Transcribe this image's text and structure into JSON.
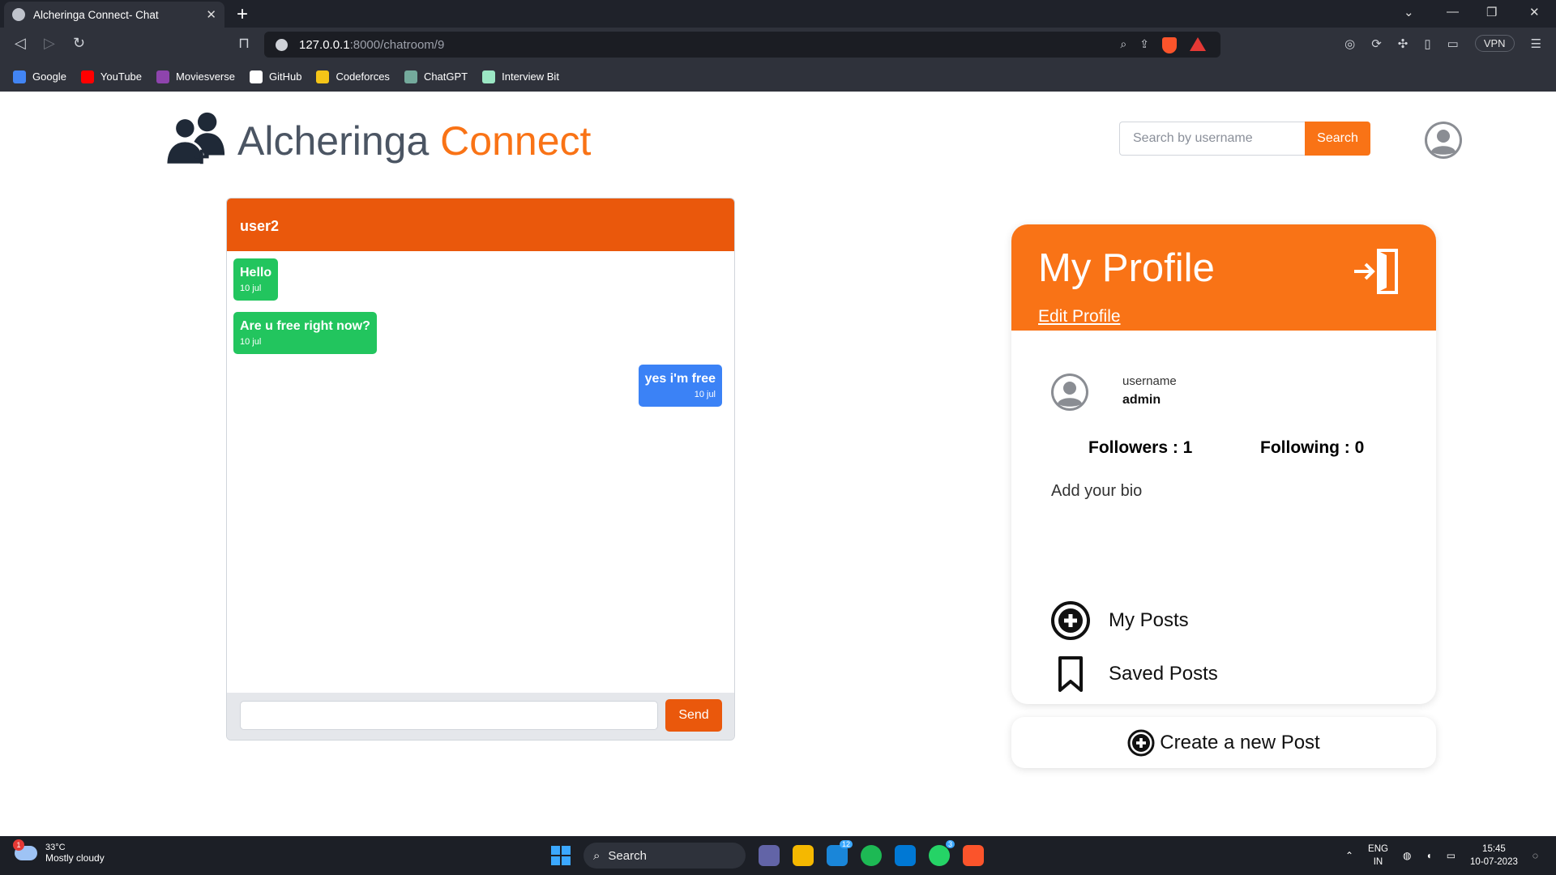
{
  "browser": {
    "tab_title": "Alcheringa Connect- Chat",
    "url_host": "127.0.0.1",
    "url_path": ":8000/chatroom/9",
    "vpn_label": "VPN",
    "bookmarks": [
      {
        "label": "Google",
        "color": "#4285f4",
        "icon": "google-icon"
      },
      {
        "label": "YouTube",
        "color": "#ff0000",
        "icon": "youtube-icon"
      },
      {
        "label": "Moviesverse",
        "color": "#8e44ad",
        "icon": "moviesverse-icon"
      },
      {
        "label": "GitHub",
        "color": "#ffffff",
        "icon": "github-icon"
      },
      {
        "label": "Codeforces",
        "color": "#f5c518",
        "icon": "codeforces-icon"
      },
      {
        "label": "ChatGPT",
        "color": "#74aa9c",
        "icon": "chatgpt-icon"
      },
      {
        "label": "Interview Bit",
        "color": "#9be7c4",
        "icon": "interviewbit-icon"
      }
    ]
  },
  "header": {
    "logo_part1": "Alcheringa ",
    "logo_part2": "Connect",
    "search_placeholder": "Search by username",
    "search_button": "Search"
  },
  "chat": {
    "recipient": "user2",
    "messages": [
      {
        "text": "Hello",
        "time": "10 jul",
        "direction": "in"
      },
      {
        "text": "Are u free right now?",
        "time": "10 jul",
        "direction": "in"
      },
      {
        "text": "yes i'm free",
        "time": "10 jul",
        "direction": "out"
      }
    ],
    "send_button": "Send"
  },
  "profile": {
    "title": "My Profile",
    "edit_link": "Edit Profile",
    "username_label": "username",
    "username": "admin",
    "followers": "Followers : 1",
    "following": "Following : 0",
    "bio": "Add your bio",
    "my_posts": "My Posts",
    "saved_posts": "Saved Posts",
    "create_post": "Create a new Post"
  },
  "taskbar": {
    "weather_badge": "1",
    "temperature": "33°C",
    "weather": "Mostly cloudy",
    "search": "Search",
    "outlook_badge": "12",
    "whatsapp_badge": "3",
    "lang_top": "ENG",
    "lang_bottom": "IN",
    "time": "15:45",
    "date": "10-07-2023"
  },
  "colors": {
    "brand_orange": "#f97316",
    "chat_header": "#ea580c",
    "incoming": "#22c55e",
    "outgoing": "#3b82f6"
  }
}
